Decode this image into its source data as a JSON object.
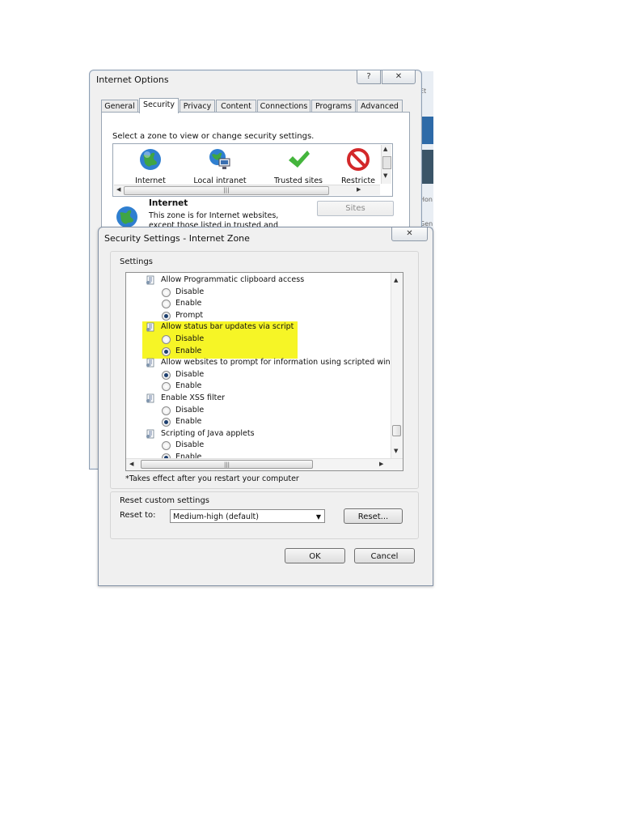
{
  "background_app": {
    "snippets": [
      "Et",
      "Hon",
      "Gen"
    ]
  },
  "internet_options": {
    "title": "Internet Options",
    "help_label": "?",
    "close_label": "✕",
    "tabs": [
      "General",
      "Security",
      "Privacy",
      "Content",
      "Connections",
      "Programs",
      "Advanced"
    ],
    "active_tab": "Security",
    "zone_prompt": "Select a zone to view or change security settings.",
    "zones": [
      {
        "label": "Internet",
        "icon": "globe-icon"
      },
      {
        "label": "Local intranet",
        "icon": "intranet-icon"
      },
      {
        "label": "Trusted sites",
        "icon": "checkmark-icon"
      },
      {
        "label": "Restricte",
        "icon": "restricted-icon"
      }
    ],
    "selected_zone_title": "Internet",
    "selected_zone_desc_line1": "This zone is for Internet websites,",
    "selected_zone_desc_line2": "except those listed in trusted and",
    "sites_button": "Sites",
    "scroll_grip": "|||"
  },
  "security_settings": {
    "title": "Security Settings - Internet Zone",
    "close_label": "✕",
    "settings_label": "Settings",
    "items": [
      {
        "type": "heading",
        "text": "Allow Programmatic clipboard access"
      },
      {
        "type": "option",
        "text": "Disable",
        "checked": false
      },
      {
        "type": "option",
        "text": "Enable",
        "checked": false
      },
      {
        "type": "option",
        "text": "Prompt",
        "checked": true
      },
      {
        "type": "heading",
        "text": "Allow status bar updates via script"
      },
      {
        "type": "option",
        "text": "Disable",
        "checked": false
      },
      {
        "type": "option",
        "text": "Enable",
        "checked": true
      },
      {
        "type": "heading",
        "text": "Allow websites to prompt for information using scripted windo"
      },
      {
        "type": "option",
        "text": "Disable",
        "checked": true
      },
      {
        "type": "option",
        "text": "Enable",
        "checked": false
      },
      {
        "type": "heading",
        "text": "Enable XSS filter"
      },
      {
        "type": "option",
        "text": "Disable",
        "checked": false
      },
      {
        "type": "option",
        "text": "Enable",
        "checked": true
      },
      {
        "type": "heading",
        "text": "Scripting of Java applets"
      },
      {
        "type": "option",
        "text": "Disable",
        "checked": false
      },
      {
        "type": "option",
        "text": "Enable",
        "checked": true
      }
    ],
    "highlight_color": "#f6f526",
    "scroll_grip": "|||",
    "restart_note": "*Takes effect after you restart your computer",
    "reset_group_label": "Reset custom settings",
    "reset_to_label": "Reset to:",
    "reset_to_value": "Medium-high (default)",
    "reset_button": "Reset...",
    "ok_button": "OK",
    "cancel_button": "Cancel"
  }
}
